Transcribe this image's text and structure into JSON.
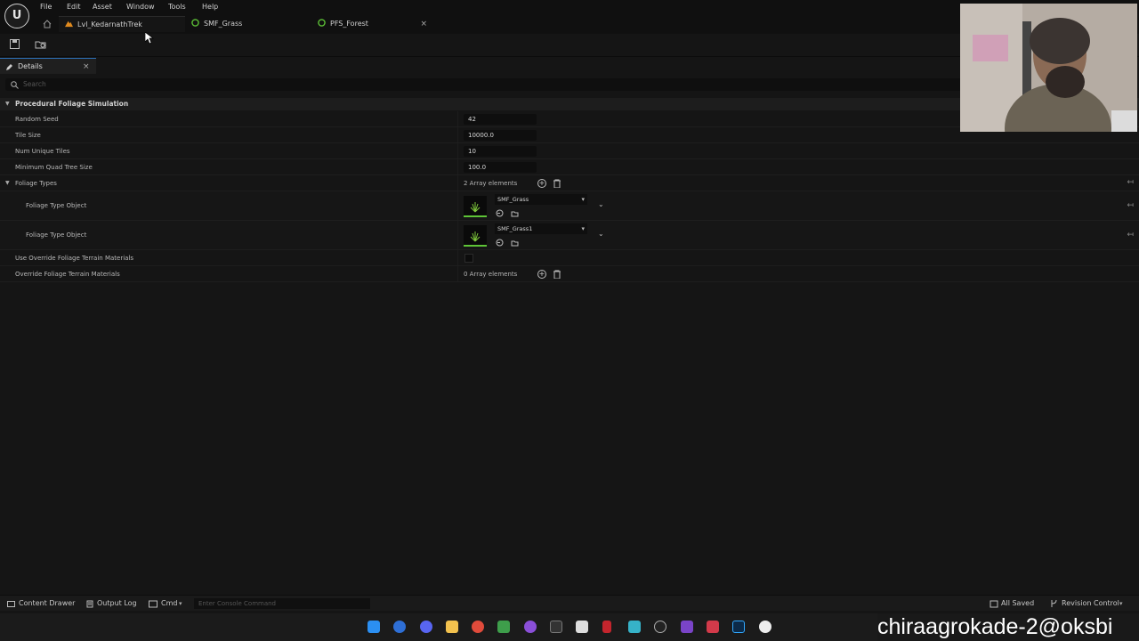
{
  "menu": [
    "File",
    "Edit",
    "Asset",
    "Window",
    "Tools",
    "Help"
  ],
  "tabs": [
    {
      "label": "Lvl_KedarnathTrek",
      "icon": "level-icon"
    },
    {
      "label": "SMF_Grass",
      "icon": "foliage-icon"
    },
    {
      "label": "PFS_Forest",
      "icon": "foliage-icon"
    }
  ],
  "details": {
    "tab_label": "Details",
    "search_placeholder": "Search",
    "section": "Procedural Foliage Simulation",
    "rows": [
      {
        "label": "Random Seed",
        "value": "42"
      },
      {
        "label": "Tile Size",
        "value": "10000.0"
      },
      {
        "label": "Num Unique Tiles",
        "value": "10"
      },
      {
        "label": "Minimum Quad Tree Size",
        "value": "100.0"
      }
    ],
    "foliage_types": {
      "label": "Foliage Types",
      "count_text": "2 Array elements",
      "items": [
        {
          "label": "Foliage Type Object",
          "asset": "SMF_Grass"
        },
        {
          "label": "Foliage Type Object",
          "asset": "SMF_Grass1"
        }
      ]
    },
    "use_override_label": "Use Override Foliage Terrain Materials",
    "use_override_checked": false,
    "override_materials": {
      "label": "Override Foliage Terrain Materials",
      "count_text": "0 Array elements"
    }
  },
  "statusbar": {
    "content_drawer": "Content Drawer",
    "output_log": "Output Log",
    "cmd": "Cmd",
    "console_placeholder": "Enter Console Command",
    "saved": "All Saved",
    "revision": "Revision Control"
  },
  "watermark": "chiraagrokade-2@oksbi",
  "colors": {
    "accent": "#2c6fb5",
    "foliage_green": "#5ec437",
    "level_orange": "#e08a1e"
  }
}
